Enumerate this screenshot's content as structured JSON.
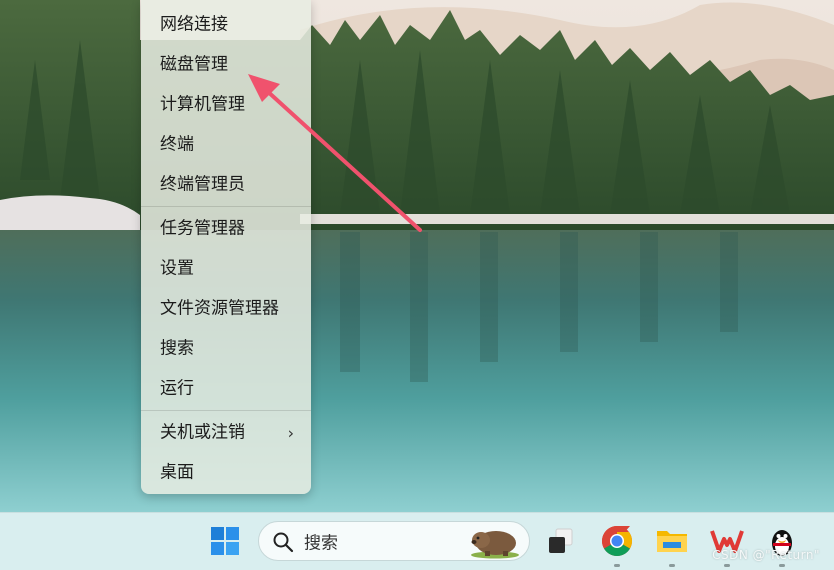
{
  "context_menu": {
    "items": [
      {
        "label": "网络连接"
      },
      {
        "label": "磁盘管理"
      },
      {
        "label": "计算机管理"
      },
      {
        "label": "终端"
      },
      {
        "label": "终端管理员"
      },
      {
        "label": "任务管理器"
      },
      {
        "label": "设置"
      },
      {
        "label": "文件资源管理器"
      },
      {
        "label": "搜索"
      },
      {
        "label": "运行"
      },
      {
        "label": "关机或注销",
        "submenu": true,
        "chevron": "›"
      },
      {
        "label": "桌面"
      }
    ]
  },
  "annotation": {
    "type": "arrow",
    "color": "#f0526d",
    "points_to": "磁盘管理"
  },
  "taskbar": {
    "search_placeholder": "搜索",
    "icons": [
      "windows-start-icon",
      "search-icon",
      "wombat-illustration",
      "task-view-icon",
      "chrome-icon",
      "file-explorer-icon",
      "wps-office-icon",
      "qq-penguin-icon"
    ],
    "watermark": "CSDN @\"Return\""
  },
  "colors": {
    "taskbar": "#d9eeef",
    "menu": "#e8ece2",
    "accent_windows": "#1e7fd8"
  }
}
